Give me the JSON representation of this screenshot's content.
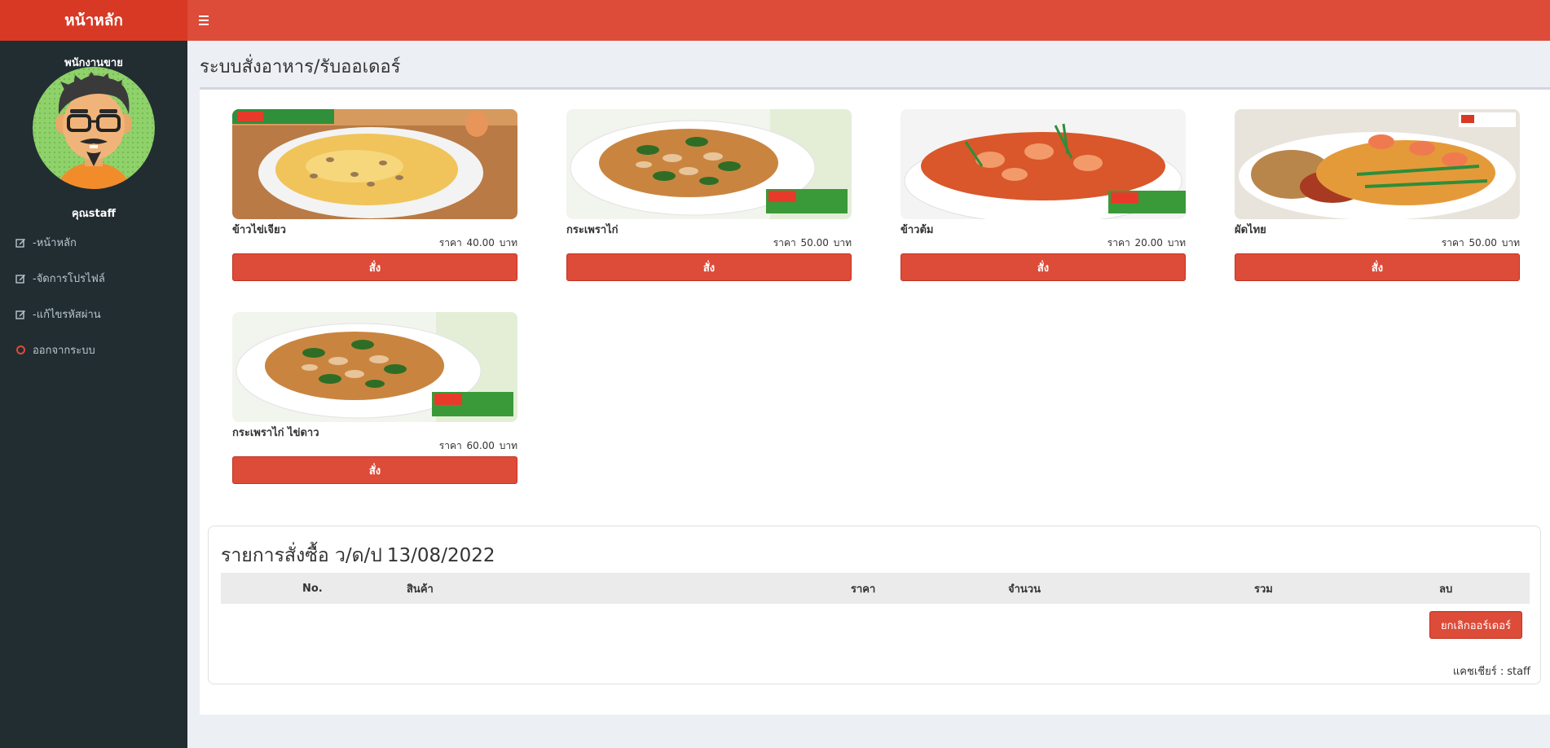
{
  "header": {
    "brand": "หน้าหลัก",
    "toggle_icon": "hamburger-menu-icon"
  },
  "sidebar": {
    "role": "พนักงานขาย",
    "avatar_icon": "cartoon-avatar",
    "username": "คุณstaff",
    "items": [
      {
        "label": "-หน้าหลัก",
        "icon": "edit-icon"
      },
      {
        "label": "-จัดการโปรไฟล์",
        "icon": "edit-icon"
      },
      {
        "label": "-แก้ไขรหัสผ่าน",
        "icon": "edit-icon"
      },
      {
        "label": "ออกจากระบบ",
        "icon": "circle-icon"
      }
    ]
  },
  "page": {
    "title": "ระบบสั่งอาหาร/รับออเดอร์"
  },
  "menu_items": [
    {
      "name": "ข้าวไข่เจียว",
      "price_label": "ราคา",
      "price": "40.00",
      "unit": "บาท",
      "button": "สั่ง"
    },
    {
      "name": "กระเพราไก่",
      "price_label": "ราคา",
      "price": "50.00",
      "unit": "บาท",
      "button": "สั่ง"
    },
    {
      "name": "ข้าวต้ม",
      "price_label": "ราคา",
      "price": "20.00",
      "unit": "บาท",
      "button": "สั่ง"
    },
    {
      "name": "ผัดไทย",
      "price_label": "ราคา",
      "price": "50.00",
      "unit": "บาท",
      "button": "สั่ง"
    },
    {
      "name": "กระเพราไก่ ไข่ดาว",
      "price_label": "ราคา",
      "price": "60.00",
      "unit": "บาท",
      "button": "สั่ง"
    }
  ],
  "order": {
    "title": "รายการสั่งซื้อ ว/ด/ป",
    "date": "13/08/2022",
    "columns": [
      "No.",
      "สินค้า",
      "ราคา",
      "จำนวน",
      "รวม",
      "ลบ"
    ],
    "cancel_button": "ยกเลิกออร์เดอร์",
    "cashier_label": "แคชเชียร์ :",
    "cashier_name": "staff"
  },
  "colors": {
    "primary": "#dd4b39",
    "sidebar": "#222d32",
    "background": "#ecf0f5"
  }
}
